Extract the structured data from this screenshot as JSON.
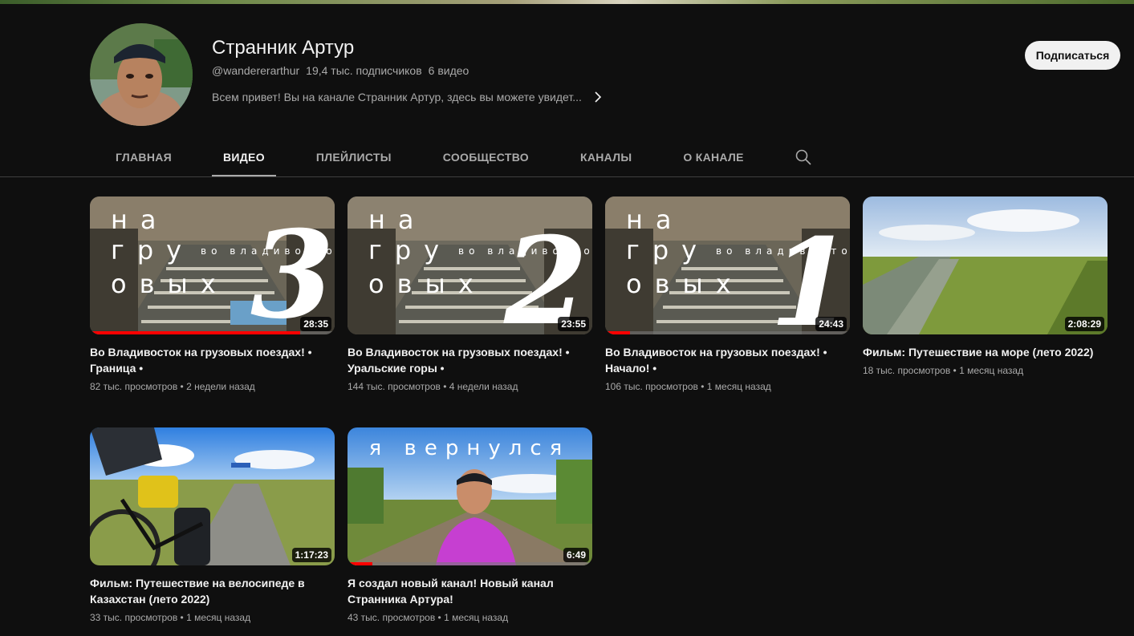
{
  "channel": {
    "name": "Странник Артур",
    "handle": "@wandererarthur",
    "subscribers": "19,4 тыс. подписчиков",
    "video_count": "6 видео",
    "description": "Всем привет! Вы на канале Странник Артур, здесь вы можете увидет...",
    "subscribe_label": "Подписаться"
  },
  "tabs": [
    {
      "label": "ГЛАВНАЯ"
    },
    {
      "label": "ВИДЕО"
    },
    {
      "label": "ПЛЕЙЛИСТЫ"
    },
    {
      "label": "СООБЩЕСТВО"
    },
    {
      "label": "КАНАЛЫ"
    },
    {
      "label": "О КАНАЛЕ"
    }
  ],
  "videos": [
    {
      "title": "Во Владивосток на грузовых поездах! • Граница •",
      "views": "82 тыс. просмотров",
      "age": "2 недели назад",
      "duration": "28:35",
      "watched": 0.86,
      "overlay": [
        "на",
        "гру",
        "овых",
        "во владивосток"
      ],
      "big_number": "3"
    },
    {
      "title": "Во Владивосток на грузовых поездах! • Уральские горы •",
      "views": "144 тыс. просмотров",
      "age": "4 недели назад",
      "duration": "23:55",
      "watched": 0,
      "overlay": [
        "на",
        "гру",
        "овых",
        "во владивосток"
      ],
      "big_number": "2"
    },
    {
      "title": "Во Владивосток на грузовых поездах! • Начало! •",
      "views": "106 тыс. просмотров",
      "age": "1 месяц назад",
      "duration": "24:43",
      "watched": 0.1,
      "overlay": [
        "на",
        "гру",
        "овых",
        "во владивосток"
      ],
      "big_number": "1"
    },
    {
      "title": "Фильм: Путешествие на море (лето 2022)",
      "views": "18 тыс. просмотров",
      "age": "1 месяц назад",
      "duration": "2:08:29",
      "watched": 0
    },
    {
      "title": "Фильм: Путешествие на велосипеде в Казахстан (лето 2022)",
      "views": "33 тыс. просмотров",
      "age": "1 месяц назад",
      "duration": "1:17:23",
      "watched": 0
    },
    {
      "title": "Я создал новый канал! Новый канал Странника Артура!",
      "views": "43 тыс. просмотров",
      "age": "1 месяц назад",
      "duration": "6:49",
      "watched": 0.1,
      "overlay": [
        "я вернулся"
      ]
    }
  ],
  "meta_separator": "•",
  "icons": {
    "search": "search-icon",
    "chevron": "chevron-right-icon"
  }
}
